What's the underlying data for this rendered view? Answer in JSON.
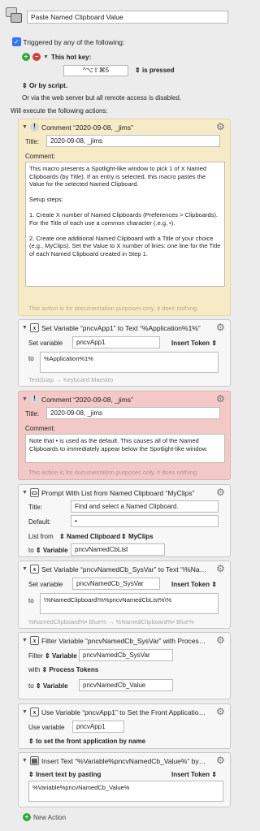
{
  "macro": {
    "name": "Paste Named Clipboard Value"
  },
  "trigger": {
    "check_label": "Triggered by any of the following:",
    "hotkey_label": "This hot key:",
    "hotkey_value": "^⌥⇧⌘5",
    "pressed_label": "is pressed",
    "or_script": "Or by script.",
    "web_text": "Or via the web server but all remote access is disabled.",
    "will_execute": "Will execute the following actions:"
  },
  "actions": {
    "comment1": {
      "header": "Comment “2020-09-08, _jims”",
      "title_label": "Title:",
      "title_value": "2020-09-08, _jims",
      "comment_label": "Comment:",
      "comment_text": "This macro presents a Spotlight-like window to pick 1 of X Named Clipboards (by Title). If an entry is selected, this macro pastes the Value for the selected Named Clipboard.\n\nSetup steps:\n\n1. Create X number of Named Clipboards (Preferences > Clipboards). For the Title of each use a common character (.e.g, •).\n\n2. Create one additional Named Clipboard with a Title of your choice (e.g., MyClips). Set the Value to X number of lines: one line for the Title of each Named Clipboard created in Step 1.",
      "note": "This action is for documentation purposes only, it does nothing."
    },
    "setvar1": {
      "header": "Set Variable “pncvApp1” to Text “%Application%1%”",
      "set_label": "Set variable",
      "var_value": "pncvApp1",
      "insert_token": "Insert Token",
      "to_label": "to",
      "text_value": "%Application%1%",
      "footer": "TextSoap → Keyboard Maestro"
    },
    "comment2": {
      "header": "Comment “2020-09-08, _jims”",
      "title_label": "Title:",
      "title_value": "2020-09-08, _jims",
      "comment_label": "Comment:",
      "comment_text": "Note that • is used as the default. This causes all of the Named Clipboards to immediately appear below the Spotlight-like window.",
      "note": "This action is for documentation purposes only, it does nothing."
    },
    "prompt": {
      "header": "Prompt With List from Named Clipboard “MyClips”",
      "title_label": "Title:",
      "title_value": "Find and select a Named Clipboard.",
      "default_label": "Default:",
      "default_value": "•",
      "list_from_label": "List from",
      "list_source": "Named Clipboard",
      "list_name": "MyClips",
      "to_label": "to",
      "to_type": "Variable",
      "to_value": "pncvNamedCbList"
    },
    "setvar2": {
      "header": "Set Variable “pncvNamedCb_SysVar” to Text “\\%Na…",
      "set_label": "Set variable",
      "var_value": "pncvNamedCb_SysVar",
      "insert_token": "Insert Token",
      "to_label": "to",
      "text_value": "\\%NamedClipboard\\%%pncvNamedCbList%\\%",
      "footer": "%NamedClipboard%• Blue% → %NamedClipboard%• Blue%"
    },
    "filter": {
      "header": "Filter Variable “pncvNamedCb_SysVar” with Proces…",
      "filter_label": "Filter",
      "filter_type": "Variable",
      "filter_value": "pncvNamedCb_SysVar",
      "with_label": "with",
      "with_value": "Process Tokens",
      "to_label": "to",
      "to_type": "Variable",
      "to_value": "pncvNamedCb_Value"
    },
    "usevar": {
      "header": "Use Variable “pncvApp1” to Set the Front Applicatio…",
      "use_label": "Use variable",
      "var_value": "pncvApp1",
      "set_front": "to set the front application by name"
    },
    "insert": {
      "header": "Insert Text “%Variable%pncvNamedCb_Value%” by…",
      "insert_label": "Insert text by pasting",
      "insert_token": "Insert Token",
      "text_value": "%Variable%pncvNamedCb_Value%"
    }
  },
  "new_action": "New Action"
}
